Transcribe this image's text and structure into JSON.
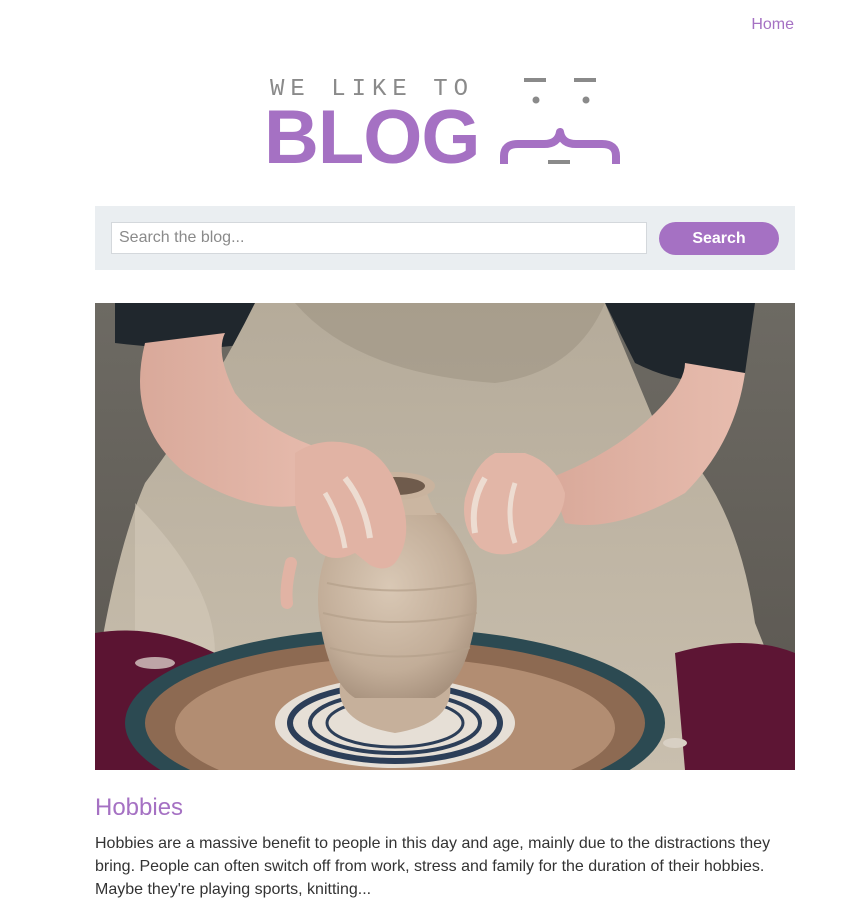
{
  "nav": {
    "home_label": "Home"
  },
  "logo": {
    "small_text": "WE LIKE TO",
    "big_text": "BLOG"
  },
  "search": {
    "placeholder": "Search the blog...",
    "button_label": "Search"
  },
  "post": {
    "image_description_icon": "pottery-photo",
    "title": "Hobbies",
    "excerpt": "Hobbies are a massive benefit to people in this day and age, mainly due to the distractions they bring. People can often switch off from work, stress and family for the duration of their hobbies. Maybe they're playing sports, knitting..."
  },
  "colors": {
    "accent": "#a571c3",
    "logo_gray": "#8a8a8a",
    "search_bg": "#eaeef1",
    "text": "#333333"
  }
}
